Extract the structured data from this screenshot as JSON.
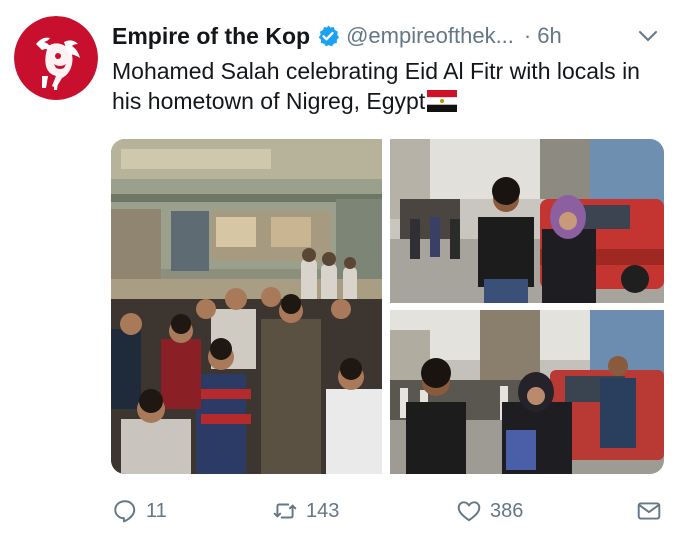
{
  "tweet": {
    "display_name": "Empire of the Kop",
    "handle": "@empireofthek...",
    "separator": "·",
    "time": "6h",
    "verified": true,
    "text": "Mohamed Salah celebrating Eid Al Fitr with locals in his hometown of Nigreg, Egypt",
    "flag_icon": "egypt-flag-icon"
  },
  "actions": {
    "reply_count": "11",
    "retweet_count": "143",
    "like_count": "386"
  },
  "colors": {
    "text": "#14171a",
    "secondary": "#657786",
    "verified_blue": "#1da1f2",
    "avatar_red": "#c8102e"
  },
  "icons": [
    "liver-bird-logo",
    "verified-icon",
    "chevron-down-icon",
    "reply-icon",
    "retweet-icon",
    "heart-icon",
    "share-icon"
  ]
}
